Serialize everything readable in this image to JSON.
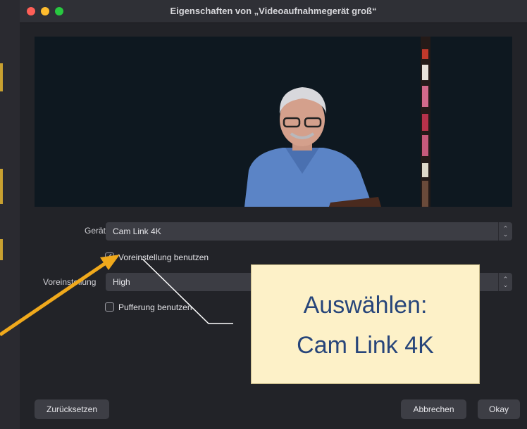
{
  "window": {
    "title": "Eigenschaften von „Videoaufnahmegerät groß“"
  },
  "preview": {
    "content": "camera-preview"
  },
  "form": {
    "device_label": "Gerät",
    "device_value": "Cam Link 4K",
    "use_preset_label": "Voreinstellung benutzen",
    "use_preset_checked": true,
    "preset_label": "Voreinstellung",
    "preset_value": "High",
    "buffering_label": "Pufferung benutzen",
    "buffering_checked": false
  },
  "buttons": {
    "reset": "Zurücksetzen",
    "cancel": "Abbrechen",
    "ok": "Okay"
  },
  "annotation": {
    "line1": "Auswählen:",
    "line2": "Cam Link 4K",
    "arrow_color": "#f0a91c",
    "callout_color": "#fdf1c8"
  }
}
